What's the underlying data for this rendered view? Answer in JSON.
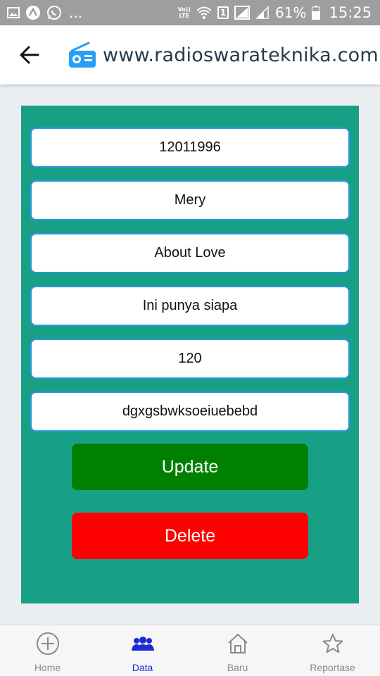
{
  "status_bar": {
    "dots": "...",
    "volte_top": "Vo))",
    "volte_bottom": "LTE",
    "sim_slot": "1",
    "battery": "61%",
    "time": "15:25"
  },
  "app_bar": {
    "title": "www.radioswarateknika.com"
  },
  "form": {
    "fields": [
      {
        "value": "12011996"
      },
      {
        "value": "Mery"
      },
      {
        "value": "About Love"
      },
      {
        "value": "Ini punya siapa"
      },
      {
        "value": "120"
      },
      {
        "value": "dgxgsbwksoeiuebebd"
      }
    ],
    "update_label": "Update",
    "delete_label": "Delete"
  },
  "bottom_nav": {
    "items": [
      {
        "label": "Home",
        "icon": "plus-circle-icon",
        "active": false
      },
      {
        "label": "Data",
        "icon": "group-icon",
        "active": true
      },
      {
        "label": "Baru",
        "icon": "house-icon",
        "active": false
      },
      {
        "label": "Reportase",
        "icon": "star-icon",
        "active": false
      }
    ]
  },
  "colors": {
    "card_bg": "#17a085",
    "field_border": "#2f95e6",
    "update_bg": "#008000",
    "delete_bg": "#ff0000",
    "nav_active": "#1e2ad6",
    "nav_inactive": "#8a8a8a",
    "brand_blue": "#2a9df4",
    "status_bar_bg": "#9e9e9e"
  }
}
